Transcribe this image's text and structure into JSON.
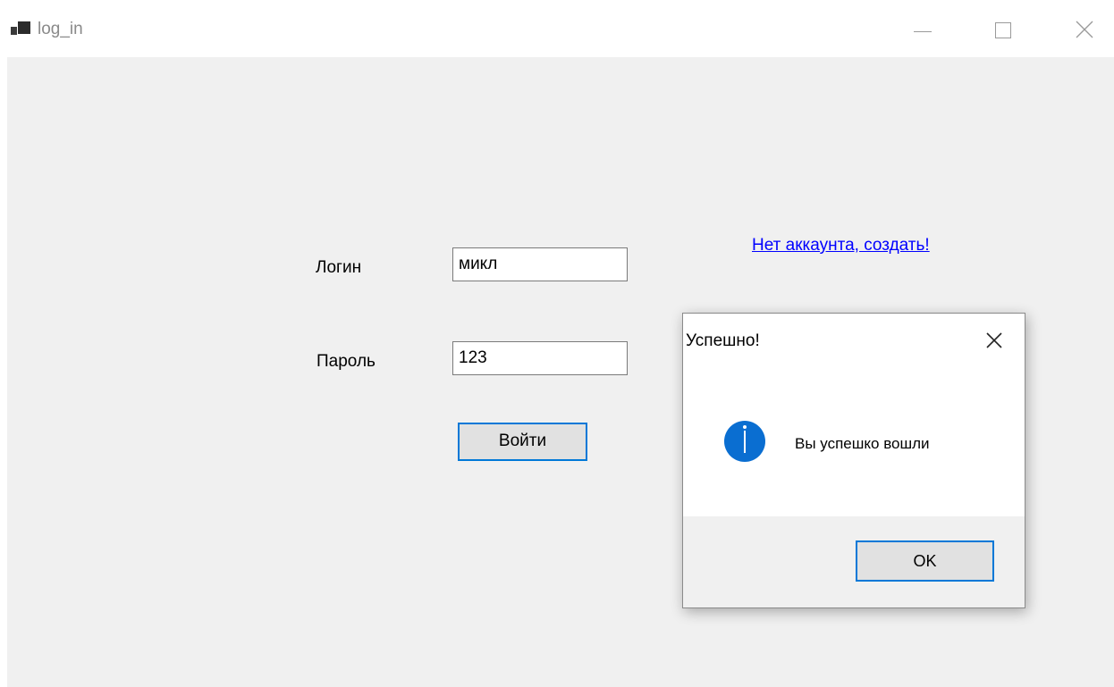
{
  "window": {
    "title": "log_in",
    "app_icon": "windows-forms-app-icon",
    "controls": [
      "minimize-icon",
      "maximize-icon",
      "close-icon"
    ]
  },
  "form": {
    "login_label": "Логин",
    "login_value": "микл",
    "password_label": "Пароль",
    "password_value": "123",
    "submit_label": "Войти",
    "create_account_link": "Нет аккаунта, создать!"
  },
  "dialog": {
    "title": "Успешно!",
    "icon": "info-icon",
    "message": "Вы успешко вошли",
    "ok_label": "OK"
  },
  "colors": {
    "accent": "#0078d7",
    "link": "#0000ff",
    "form_background": "#f0f0f0",
    "info_icon": "#0a6ed1"
  }
}
